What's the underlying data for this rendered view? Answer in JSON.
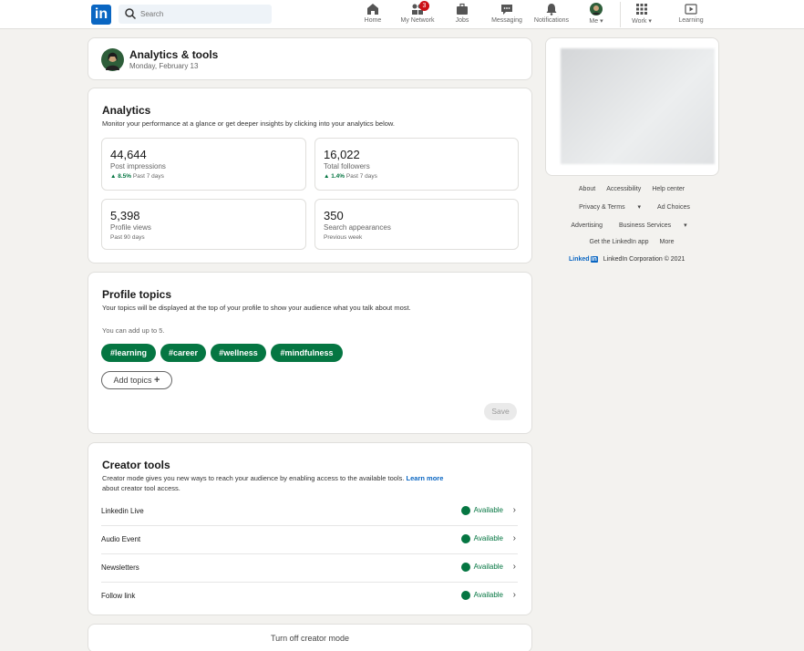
{
  "nav": {
    "search_placeholder": "Search",
    "items": [
      {
        "label": "Home",
        "icon": "home-icon"
      },
      {
        "label": "My Network",
        "icon": "network-icon",
        "badge": "3"
      },
      {
        "label": "Jobs",
        "icon": "briefcase-icon"
      },
      {
        "label": "Messaging",
        "icon": "message-icon"
      },
      {
        "label": "Notifications",
        "icon": "bell-icon"
      },
      {
        "label": "Me",
        "icon": "avatar"
      },
      {
        "label": "Work",
        "icon": "grid-icon"
      },
      {
        "label": "Learning",
        "icon": "play-icon"
      }
    ]
  },
  "header": {
    "title": "Analytics & tools",
    "date": "Monday, February 13"
  },
  "analytics": {
    "title": "Analytics",
    "desc": "Monitor your performance at a glance or get deeper insights by clicking into your analytics below.",
    "stats": [
      {
        "value": "44,644",
        "label": "Post impressions",
        "change": "8.5%",
        "period": "Past 7 days"
      },
      {
        "value": "16,022",
        "label": "Total followers",
        "change": "1.4%",
        "period": "Past 7 days"
      },
      {
        "value": "5,398",
        "label": "Profile views",
        "period": "Past 90 days"
      },
      {
        "value": "350",
        "label": "Search appearances",
        "period": "Previous week"
      }
    ]
  },
  "topics": {
    "title": "Profile topics",
    "desc": "Your topics will be displayed at the top of your profile to show your audience what you talk about most.",
    "hint": "You can add up to 5.",
    "tags": [
      "#learning",
      "#career",
      "#wellness",
      "#mindfulness"
    ],
    "add_label": "Add topics",
    "save_label": "Save"
  },
  "creator": {
    "title": "Creator tools",
    "desc": "Creator mode gives you new ways to reach your audience by enabling access to the available tools.",
    "learn_more": "Learn more",
    "desc_tail": "about creator tool access.",
    "tools": [
      {
        "name": "Linkedin Live",
        "status": "Available"
      },
      {
        "name": "Audio Event",
        "status": "Available"
      },
      {
        "name": "Newsletters",
        "status": "Available"
      },
      {
        "name": "Follow link",
        "status": "Available"
      }
    ],
    "turn_off": "Turn off creator mode"
  },
  "footer": {
    "links_row1": [
      "About",
      "Accessibility",
      "Help center"
    ],
    "links_row2": [
      "Privacy & Terms",
      "Ad Choices"
    ],
    "links_row3": [
      "Advertising",
      "Business Services"
    ],
    "links_row4": [
      "Get the LinkedIn app",
      "More"
    ],
    "brand": "Linked",
    "brand_in": "in",
    "copyright": "LinkedIn Corporation © 2021"
  },
  "colors": {
    "brand": "#0a66c2",
    "success": "#057642"
  }
}
